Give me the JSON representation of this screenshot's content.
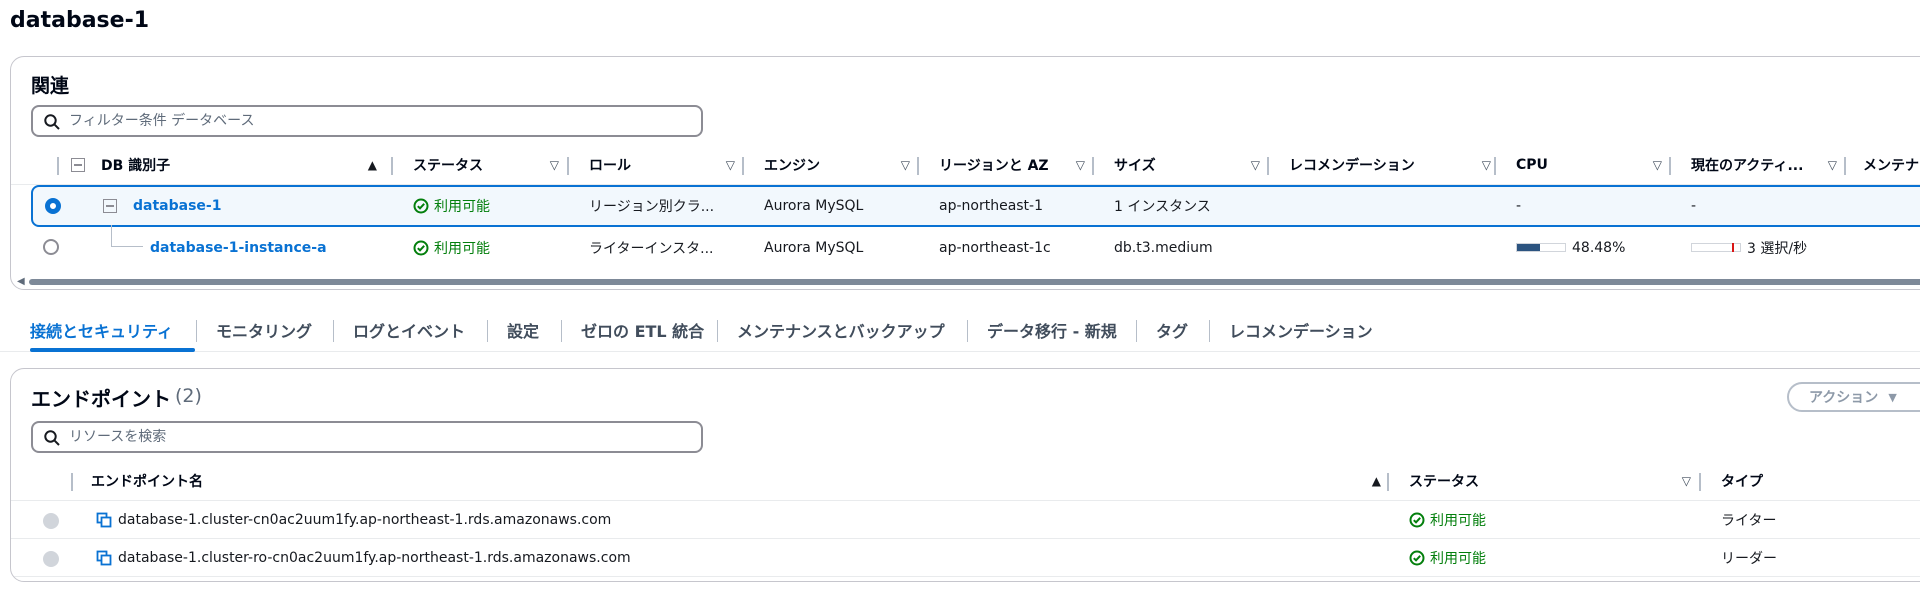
{
  "page": {
    "title": "database-1"
  },
  "related": {
    "heading": "関連",
    "search_placeholder": "フィルター条件 データベース",
    "columns": {
      "identifier": "DB 識別子",
      "status": "ステータス",
      "role": "ロール",
      "engine": "エンジン",
      "region_az": "リージョンと AZ",
      "size": "サイズ",
      "recommendation": "レコメンデーション",
      "cpu": "CPU",
      "current_activity": "現在のアクティ...",
      "maintenance": "メンテナ"
    },
    "rows": [
      {
        "identifier": "database-1",
        "status": "利用可能",
        "role": "リージョン別クラ...",
        "engine": "Aurora MySQL",
        "region_az": "ap-northeast-1",
        "size": "1 インスタンス",
        "recommendation": "",
        "cpu": "-",
        "current_activity": "-",
        "selected": true
      },
      {
        "identifier": "database-1-instance-a",
        "status": "利用可能",
        "role": "ライターインスタ...",
        "engine": "Aurora MySQL",
        "region_az": "ap-northeast-1c",
        "size": "db.t3.medium",
        "recommendation": "",
        "cpu": "48.48%",
        "cpu_fraction": 0.4848,
        "current_activity": "3 選択/秒",
        "selected": false
      }
    ]
  },
  "tabs": [
    {
      "label": "接続とセキュリティ",
      "active": true
    },
    {
      "label": "モニタリング",
      "active": false
    },
    {
      "label": "ログとイベント",
      "active": false
    },
    {
      "label": "設定",
      "active": false
    },
    {
      "label": "ゼロの ETL 統合",
      "active": false
    },
    {
      "label": "メンテナンスとバックアップ",
      "active": false
    },
    {
      "label": "データ移行 - 新規",
      "active": false
    },
    {
      "label": "タグ",
      "active": false
    },
    {
      "label": "レコメンデーション",
      "active": false
    }
  ],
  "endpoints": {
    "title": "エンドポイント",
    "count": "(2)",
    "action_label": "アクション",
    "search_placeholder": "リソースを検索",
    "columns": {
      "name": "エンドポイント名",
      "status": "ステータス",
      "type": "タイプ"
    },
    "rows": [
      {
        "name": "database-1.cluster-cn0ac2uum1fy.ap-northeast-1.rds.amazonaws.com",
        "status": "利用可能",
        "type": "ライター"
      },
      {
        "name": "database-1.cluster-ro-cn0ac2uum1fy.ap-northeast-1.rds.amazonaws.com",
        "status": "利用可能",
        "type": "リーダー"
      }
    ]
  },
  "colors": {
    "accent": "#0972d3",
    "success": "#037f0c",
    "border": "#c6c6cd",
    "meter_fill": "#2c5480",
    "meter_mark": "#d91515"
  },
  "icons": [
    "search-icon",
    "sort-asc-icon",
    "sort-desc-icon",
    "status-ok-icon",
    "expander-icon",
    "copy-icon",
    "caret-down-icon"
  ]
}
